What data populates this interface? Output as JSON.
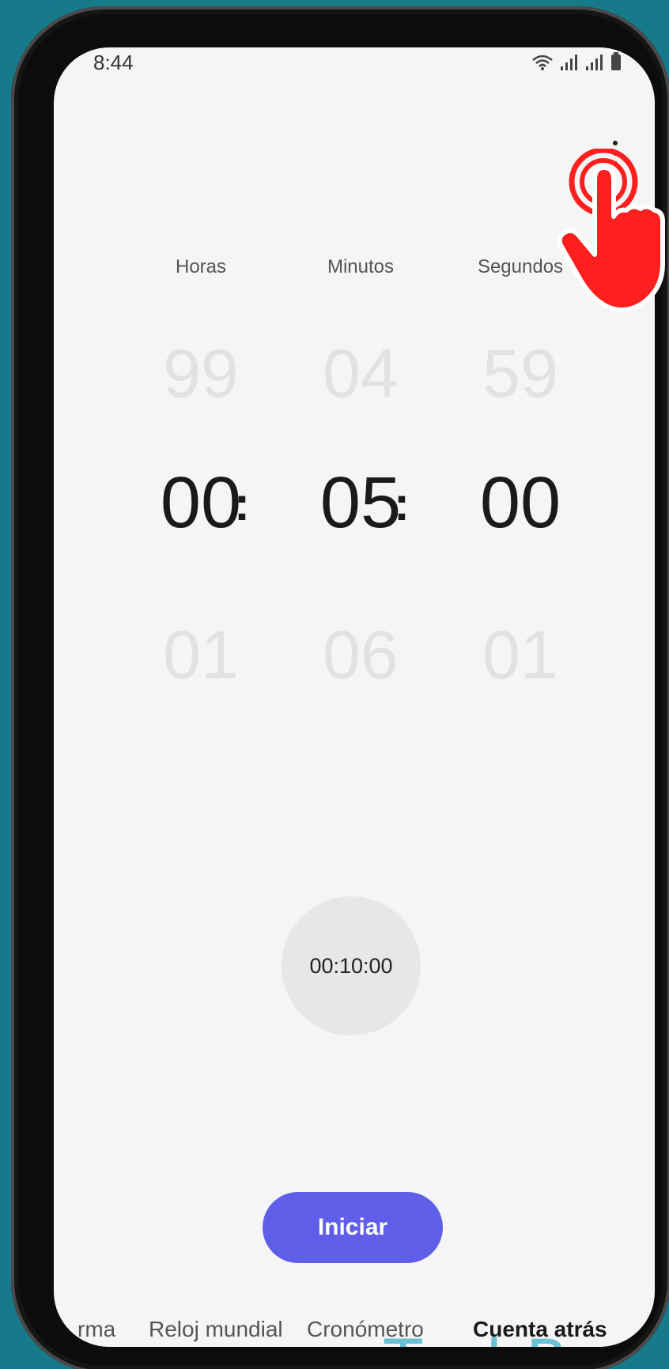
{
  "status": {
    "time": "8:44"
  },
  "menu": {
    "icon": "more-vertical-icon"
  },
  "columns": {
    "hours_label": "Horas",
    "minutes_label": "Minutos",
    "seconds_label": "Segundos"
  },
  "picker": {
    "hours": {
      "prev": "99",
      "current": "00",
      "next": "01"
    },
    "minutes": {
      "prev": "04",
      "current": "05",
      "next": "06"
    },
    "seconds": {
      "prev": "59",
      "current": "00",
      "next": "01"
    },
    "separator": ":"
  },
  "preset": {
    "label": "00:10:00"
  },
  "start_button": {
    "label": "Iniciar",
    "color": "#5e5ee8"
  },
  "tabs": [
    {
      "label": "rma"
    },
    {
      "label": "Reloj mundial"
    },
    {
      "label": "Cronómetro"
    },
    {
      "label": "Cuenta atrás",
      "active": true
    }
  ],
  "watermark": "TechBone",
  "overlay": {
    "icon": "tap-hand-icon",
    "color": "#ff1f1f"
  }
}
